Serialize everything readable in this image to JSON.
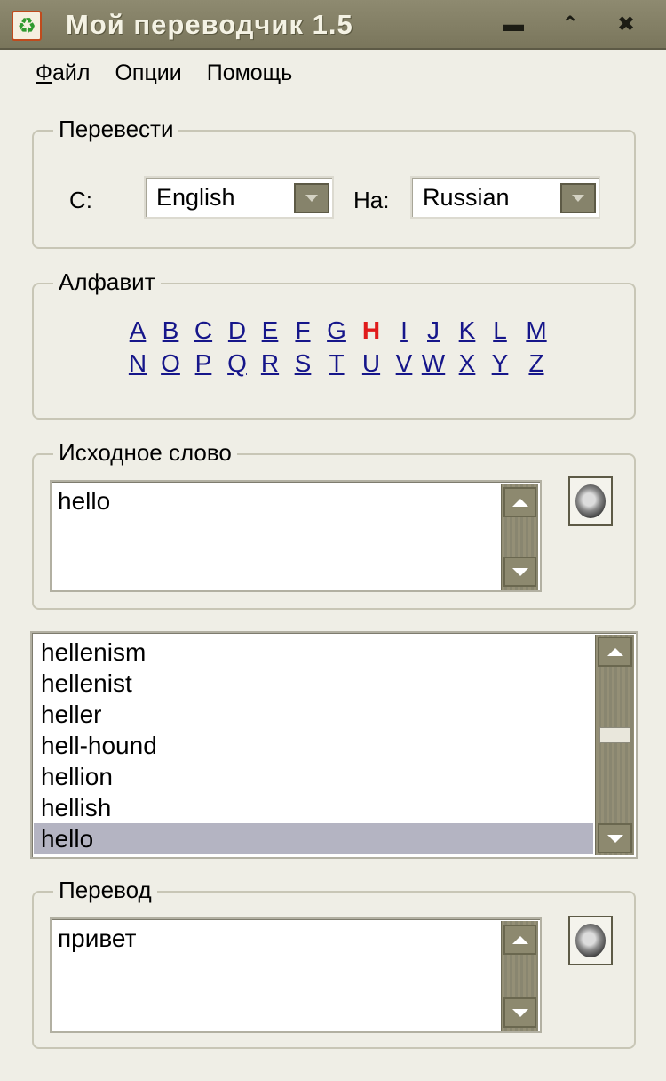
{
  "window": {
    "title": "Мой переводчик 1.5",
    "icon": "recycle-icon",
    "controls": {
      "minimize": "minimize-icon",
      "maximize": "maximize-icon",
      "close": "close-icon"
    }
  },
  "menu": [
    "Файл",
    "Опции",
    "Помощь"
  ],
  "translate_group": {
    "legend": "Перевести",
    "from_label": "С:",
    "from_value": "English",
    "to_label": "На:",
    "to_value": "Russian"
  },
  "alphabet_group": {
    "legend": "Алфавит",
    "row1": [
      "A",
      "B",
      "C",
      "D",
      "E",
      "F",
      "G",
      "H",
      "I",
      "J",
      "K",
      "L",
      "M"
    ],
    "row2": [
      "N",
      "O",
      "P",
      "Q",
      "R",
      "S",
      "T",
      "U",
      "V",
      "W",
      "X",
      "Y",
      "Z"
    ],
    "active_letter": "H"
  },
  "source_group": {
    "legend": "Исходное слово",
    "text": "hello"
  },
  "word_list": {
    "items": [
      "hellenism",
      "hellenist",
      "heller",
      "hell-hound",
      "hellion",
      "hellish",
      "hello"
    ],
    "selected_index": 6
  },
  "translation_group": {
    "legend": "Перевод",
    "text": "привет"
  },
  "colors": {
    "titlebar": "#7a765c",
    "window_bg": "#efeee6",
    "active_letter": "#e01b1b",
    "link": "#16168a",
    "selection": "#b4b4c2"
  }
}
